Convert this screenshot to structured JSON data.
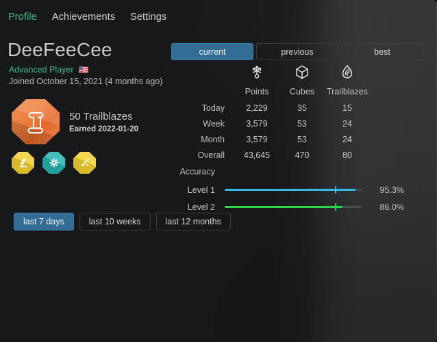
{
  "nav": {
    "items": [
      {
        "label": "Profile",
        "active": true
      },
      {
        "label": "Achievements",
        "active": false
      },
      {
        "label": "Settings",
        "active": false
      }
    ]
  },
  "profile": {
    "username": "DeeFeeCee",
    "rank": "Advanced Player",
    "flag": "🇺🇸",
    "joined": "Joined October 15, 2021 (4 months ago)"
  },
  "featured_badge": {
    "icon": "scroll-icon",
    "color": "#ef7f3e",
    "title": "50 Trailblazes",
    "earned": "Earned 2022-01-20"
  },
  "mini_badges": [
    {
      "icon": "microscope-icon",
      "color": "#f2cf2e"
    },
    {
      "icon": "starburst-icon",
      "color": "#22b3b0"
    },
    {
      "icon": "rays-icon",
      "color": "#f2cf2e"
    }
  ],
  "range_buttons": [
    {
      "label": "last 7 days",
      "active": true
    },
    {
      "label": "last 10 weeks",
      "active": false
    },
    {
      "label": "last 12 months",
      "active": false
    }
  ],
  "period_buttons": [
    {
      "label": "current",
      "active": true
    },
    {
      "label": "previous",
      "active": false
    },
    {
      "label": "best",
      "active": false
    }
  ],
  "stats": {
    "columns": [
      {
        "label": "Points",
        "icon": "snowflake-icon"
      },
      {
        "label": "Cubes",
        "icon": "cube-icon"
      },
      {
        "label": "Trailblazes",
        "icon": "flame-icon"
      }
    ],
    "rows": [
      {
        "label": "Today",
        "values": [
          "2,229",
          "35",
          "15"
        ]
      },
      {
        "label": "Week",
        "values": [
          "3,579",
          "53",
          "24"
        ]
      },
      {
        "label": "Month",
        "values": [
          "3,579",
          "53",
          "24"
        ]
      },
      {
        "label": "Overall",
        "values": [
          "43,645",
          "470",
          "80"
        ]
      }
    ]
  },
  "accuracy": {
    "title": "Accuracy",
    "rows": [
      {
        "label": "Level 1",
        "percent": "95.3%",
        "value": 95.3,
        "marker": 80.5,
        "color": "#3ab7e8"
      },
      {
        "label": "Level 2",
        "percent": "86.0%",
        "value": 86.0,
        "marker": 80.5,
        "color": "#2fd64a"
      }
    ]
  },
  "colors": {
    "accent_blue": "#336d96",
    "accent_green": "#3fb68b",
    "badge_orange": "#ef7f3e",
    "level1_bar": "#3ab7e8",
    "level2_bar": "#2fd64a",
    "track": "#4a4c50"
  }
}
